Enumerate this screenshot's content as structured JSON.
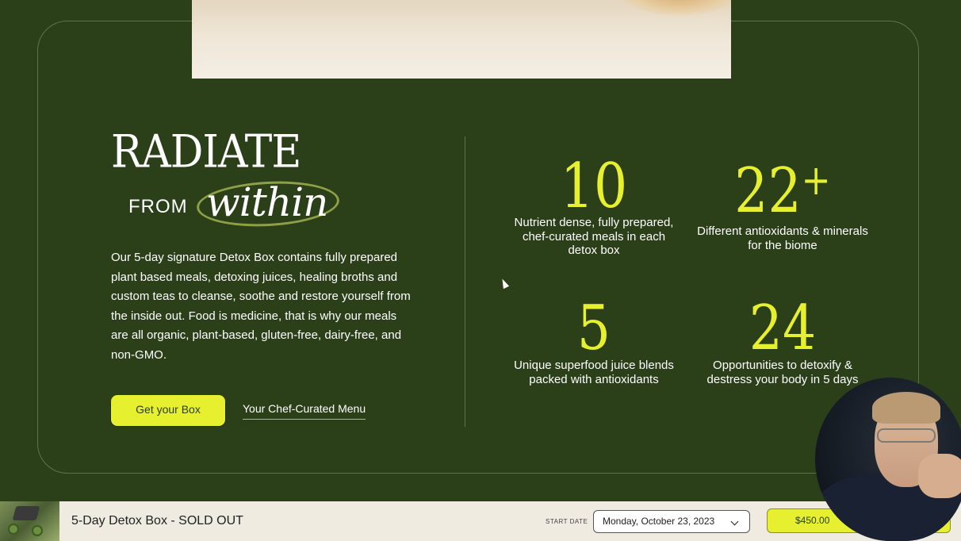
{
  "headline": {
    "line1": "RADIATE",
    "from": "FROM",
    "within": "within"
  },
  "description": "Our 5-day signature Detox Box contains fully prepared plant based meals, detoxing juices, healing broths and custom teas to cleanse, soothe and restore yourself from the inside out. Food is medicine, that is why our meals are all organic, plant-based, gluten-free, dairy-free, and non-GMO.",
  "buttons": {
    "cta": "Get your Box",
    "menu_link": "Your Chef-Curated Menu"
  },
  "stats": [
    {
      "number": "10",
      "suffix": "",
      "label": "Nutrient dense, fully prepared, chef-curated meals in each detox box"
    },
    {
      "number": "22",
      "suffix": "+",
      "label": "Different antioxidants & minerals for the biome"
    },
    {
      "number": "5",
      "suffix": "",
      "label": "Unique superfood juice blends packed with antioxidants"
    },
    {
      "number": "24",
      "suffix": "",
      "label": "Opportunities to detoxify & destress your body in 5 days"
    }
  ],
  "bottom_bar": {
    "product_title": "5-Day Detox Box - SOLD OUT",
    "start_date_label": "START DATE",
    "date_value": "Monday, October 23, 2023",
    "price": "$450.00"
  },
  "colors": {
    "background": "#2b3f19",
    "accent": "#e6f02e",
    "bar": "#f0ebe1"
  }
}
